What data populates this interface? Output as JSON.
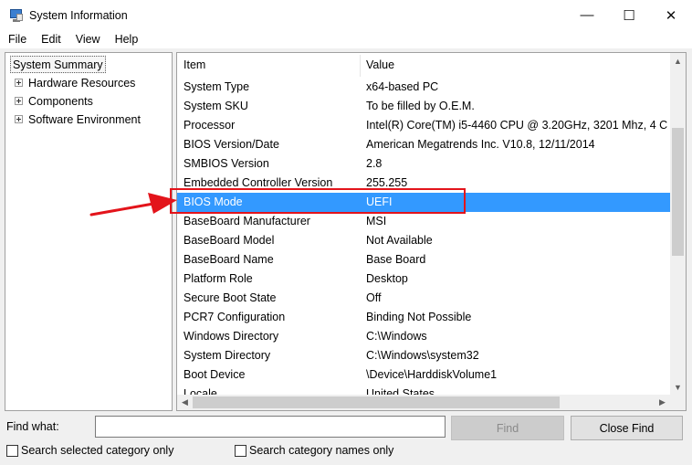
{
  "window": {
    "title": "System Information",
    "minimize": "—",
    "maximize": "☐",
    "close": "✕"
  },
  "menu": [
    "File",
    "Edit",
    "View",
    "Help"
  ],
  "tree": {
    "selected": "System Summary",
    "nodes": [
      "Hardware Resources",
      "Components",
      "Software Environment"
    ]
  },
  "list": {
    "columns": {
      "item": "Item",
      "value": "Value"
    },
    "rows": [
      {
        "item": "System Type",
        "value": "x64-based PC"
      },
      {
        "item": "System SKU",
        "value": "To be filled by O.E.M."
      },
      {
        "item": "Processor",
        "value": "Intel(R) Core(TM) i5-4460  CPU @ 3.20GHz, 3201 Mhz, 4 C"
      },
      {
        "item": "BIOS Version/Date",
        "value": "American Megatrends Inc. V10.8, 12/11/2014"
      },
      {
        "item": "SMBIOS Version",
        "value": "2.8"
      },
      {
        "item": "Embedded Controller Version",
        "value": "255.255"
      },
      {
        "item": "BIOS Mode",
        "value": "UEFI"
      },
      {
        "item": "BaseBoard Manufacturer",
        "value": "MSI"
      },
      {
        "item": "BaseBoard Model",
        "value": "Not Available"
      },
      {
        "item": "BaseBoard Name",
        "value": "Base Board"
      },
      {
        "item": "Platform Role",
        "value": "Desktop"
      },
      {
        "item": "Secure Boot State",
        "value": "Off"
      },
      {
        "item": "PCR7 Configuration",
        "value": "Binding Not Possible"
      },
      {
        "item": "Windows Directory",
        "value": "C:\\Windows"
      },
      {
        "item": "System Directory",
        "value": "C:\\Windows\\system32"
      },
      {
        "item": "Boot Device",
        "value": "\\Device\\HarddiskVolume1"
      },
      {
        "item": "Locale",
        "value": "United States"
      }
    ],
    "selected_item": "BIOS Mode"
  },
  "find": {
    "label": "Find what:",
    "value": "",
    "find_button": "Find",
    "close_button": "Close Find",
    "option_selected_category": "Search selected category only",
    "option_category_names": "Search category names only"
  },
  "colors": {
    "selection": "#3399ff",
    "annotation": "#e3141b"
  }
}
